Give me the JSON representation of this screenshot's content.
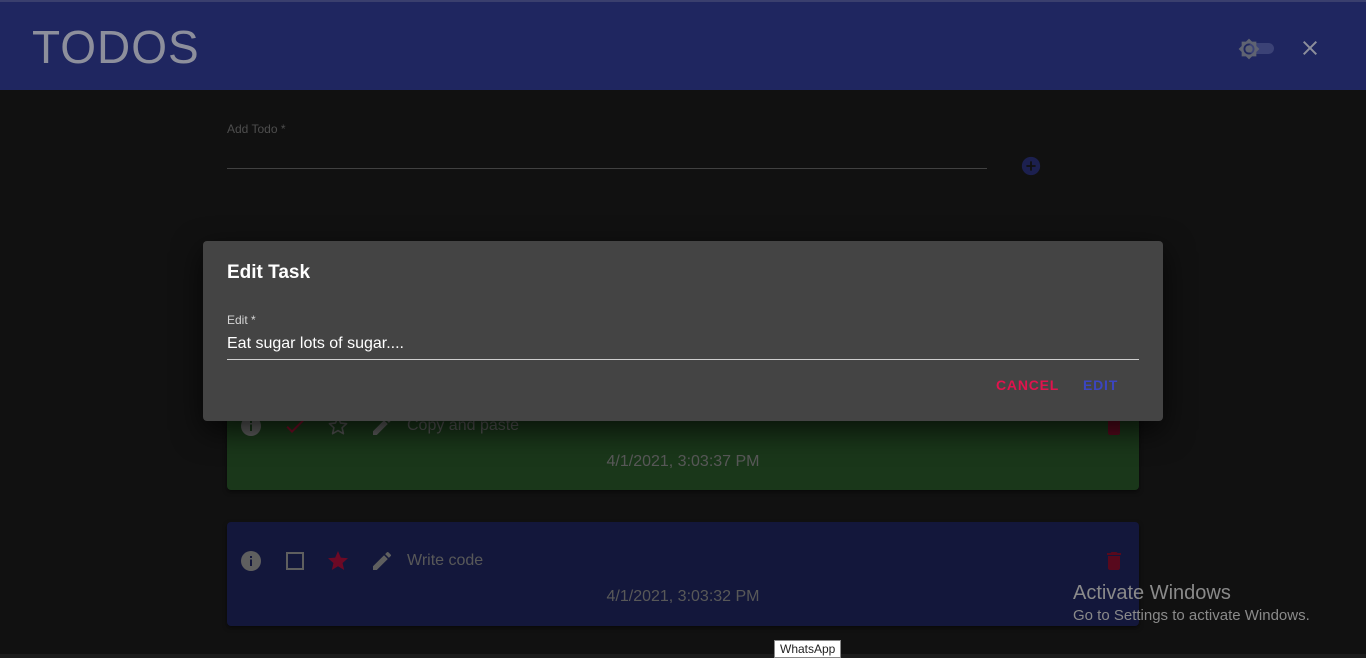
{
  "app": {
    "title": "TODOS"
  },
  "add_todo": {
    "label": "Add Todo *",
    "value": ""
  },
  "todos": [
    {
      "text": "Copy and paste",
      "timestamp": "4/1/2021, 3:03:37 PM",
      "completed": true,
      "starred": false,
      "color": "#2a5a2a"
    },
    {
      "text": "Write code",
      "timestamp": "4/1/2021, 3:03:32 PM",
      "completed": false,
      "starred": true,
      "color": "#1f2660"
    }
  ],
  "dialog": {
    "title": "Edit Task",
    "field_label": "Edit *",
    "field_value": "Eat sugar lots of sugar....",
    "cancel_label": "CANCEL",
    "edit_label": "EDIT"
  },
  "watermark": {
    "title": "Activate Windows",
    "subtitle": "Go to Settings to activate Windows."
  },
  "tooltip": {
    "text": "WhatsApp"
  },
  "colors": {
    "header": "#1f2660",
    "accent": "#3b45c0",
    "danger": "#e0134d",
    "completed_card": "#2a5a2a"
  }
}
